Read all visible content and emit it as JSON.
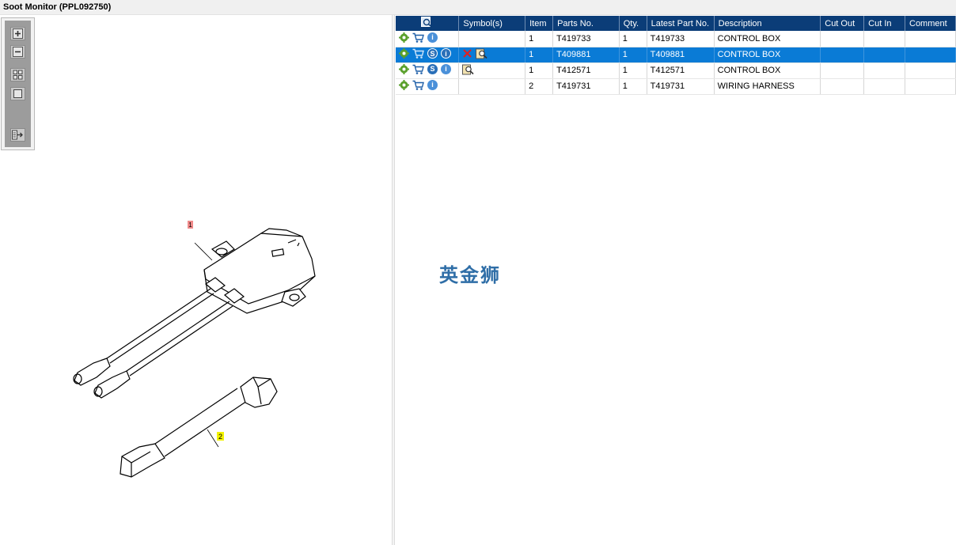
{
  "window": {
    "title": "Soot Monitor (PPL092750)"
  },
  "toolbar": {
    "buttons": [
      {
        "icon": "zoom-in-icon"
      },
      {
        "icon": "zoom-out-icon"
      },
      {
        "icon": "fit-all-icon"
      },
      {
        "icon": "actual-size-icon"
      },
      {
        "icon": "export-icon"
      }
    ]
  },
  "drawing": {
    "callouts": [
      {
        "label": "1",
        "color": "#f08a8a"
      },
      {
        "label": "2",
        "color": "#f3f300"
      }
    ]
  },
  "table": {
    "columns": [
      "",
      "Symbol(s)",
      "Item",
      "Parts No.",
      "Qty.",
      "Latest Part No.",
      "Description",
      "Cut Out",
      "Cut In",
      "Comment"
    ],
    "rows": [
      {
        "item": "1",
        "part_no": "T419733",
        "qty": "1",
        "latest_part_no": "T419733",
        "description": "CONTROL BOX",
        "cut_out": "",
        "cut_in": "",
        "comment": ""
      },
      {
        "item": "1",
        "part_no": "T409881",
        "qty": "1",
        "latest_part_no": "T409881",
        "description": "CONTROL BOX",
        "cut_out": "",
        "cut_in": "",
        "comment": ""
      },
      {
        "item": "1",
        "part_no": "T412571",
        "qty": "1",
        "latest_part_no": "T412571",
        "description": "CONTROL BOX",
        "cut_out": "",
        "cut_in": "",
        "comment": ""
      },
      {
        "item": "2",
        "part_no": "T419731",
        "qty": "1",
        "latest_part_no": "T419731",
        "description": "WIRING HARNESS",
        "cut_out": "",
        "cut_in": "",
        "comment": ""
      }
    ],
    "selected_row": 2,
    "header_color": "#0b3d78",
    "selection_color": "#0a7bd6"
  },
  "watermark": {
    "text": "英金狮"
  }
}
